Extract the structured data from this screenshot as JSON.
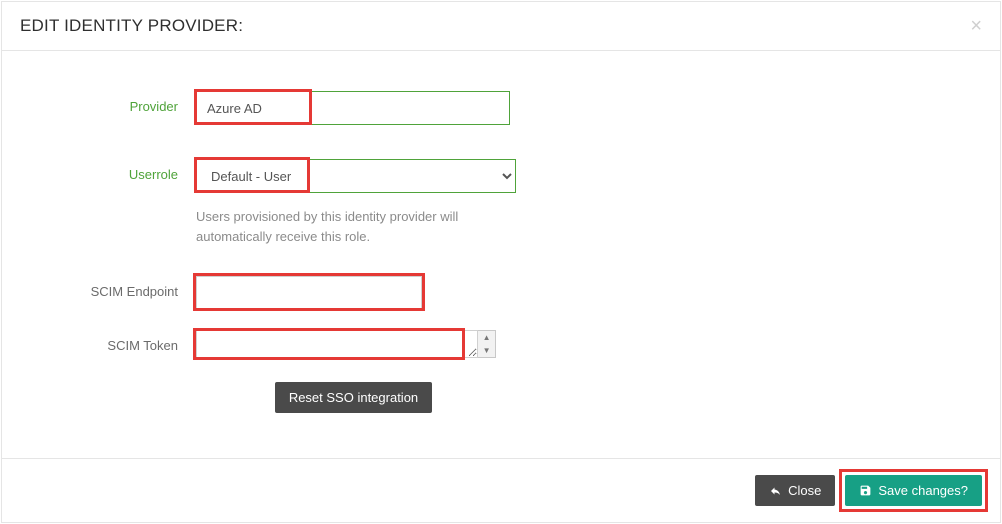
{
  "modal": {
    "title": "EDIT IDENTITY PROVIDER:"
  },
  "labels": {
    "provider": "Provider",
    "userrole": "Userrole",
    "scim_endpoint": "SCIM Endpoint",
    "scim_token": "SCIM Token"
  },
  "fields": {
    "provider_value": "Azure AD",
    "userrole_selected": "Default - User",
    "userrole_help": "Users provisioned by this identity provider will automatically receive this role.",
    "scim_endpoint_value": "",
    "scim_token_value": ""
  },
  "buttons": {
    "reset": "Reset SSO integration",
    "close": "Close",
    "save": "Save changes?"
  }
}
